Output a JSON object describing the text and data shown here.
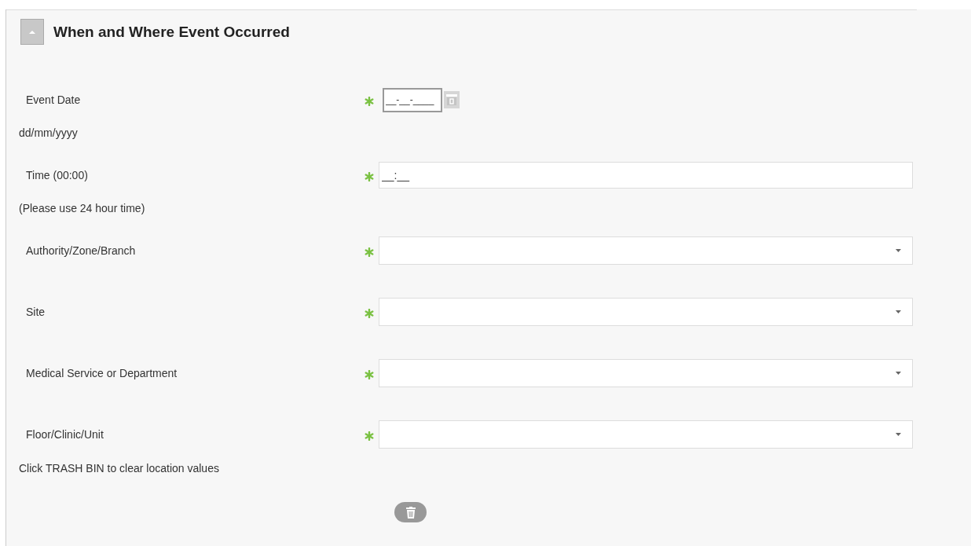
{
  "section": {
    "title": "When and Where Event Occurred",
    "expanded": true
  },
  "fields": [
    {
      "kind": "date",
      "label": "Event Date",
      "required": true,
      "value": "__-__-____",
      "hint": "dd/mm/yyyy"
    },
    {
      "kind": "time",
      "label": "Time (00:00)",
      "required": true,
      "value": "__:__",
      "hint": "(Please use 24 hour time)"
    },
    {
      "kind": "select",
      "label": "Authority/Zone/Branch",
      "required": true
    },
    {
      "kind": "select",
      "label": "Site",
      "required": true
    },
    {
      "kind": "select",
      "label": "Medical Service or Department",
      "required": true
    },
    {
      "kind": "select",
      "label": "Floor/Clinic/Unit",
      "required": true
    }
  ],
  "note": "Click TRASH BIN to clear location values"
}
